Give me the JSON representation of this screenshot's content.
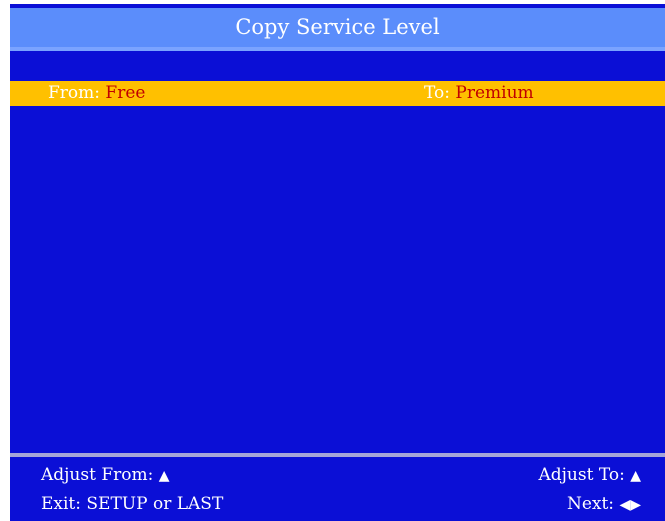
{
  "window": {
    "title": "Copy Service Level"
  },
  "selection": {
    "from_label": "From:",
    "from_value": "Free",
    "to_label": "To:",
    "to_value": "Premium"
  },
  "footer": {
    "adjust_from_label": "Adjust From:",
    "adjust_to_label": "Adjust To:",
    "exit_label": "Exit: SETUP or LAST",
    "next_label": "Next:",
    "up_glyph": "▲",
    "next_glyph": "◀▶"
  },
  "colors": {
    "background": "#0b0fd6",
    "title_bar": "#5b8dfb",
    "highlight": "#ffc000",
    "value_text": "#c00000",
    "label_text": "#ffffff"
  }
}
